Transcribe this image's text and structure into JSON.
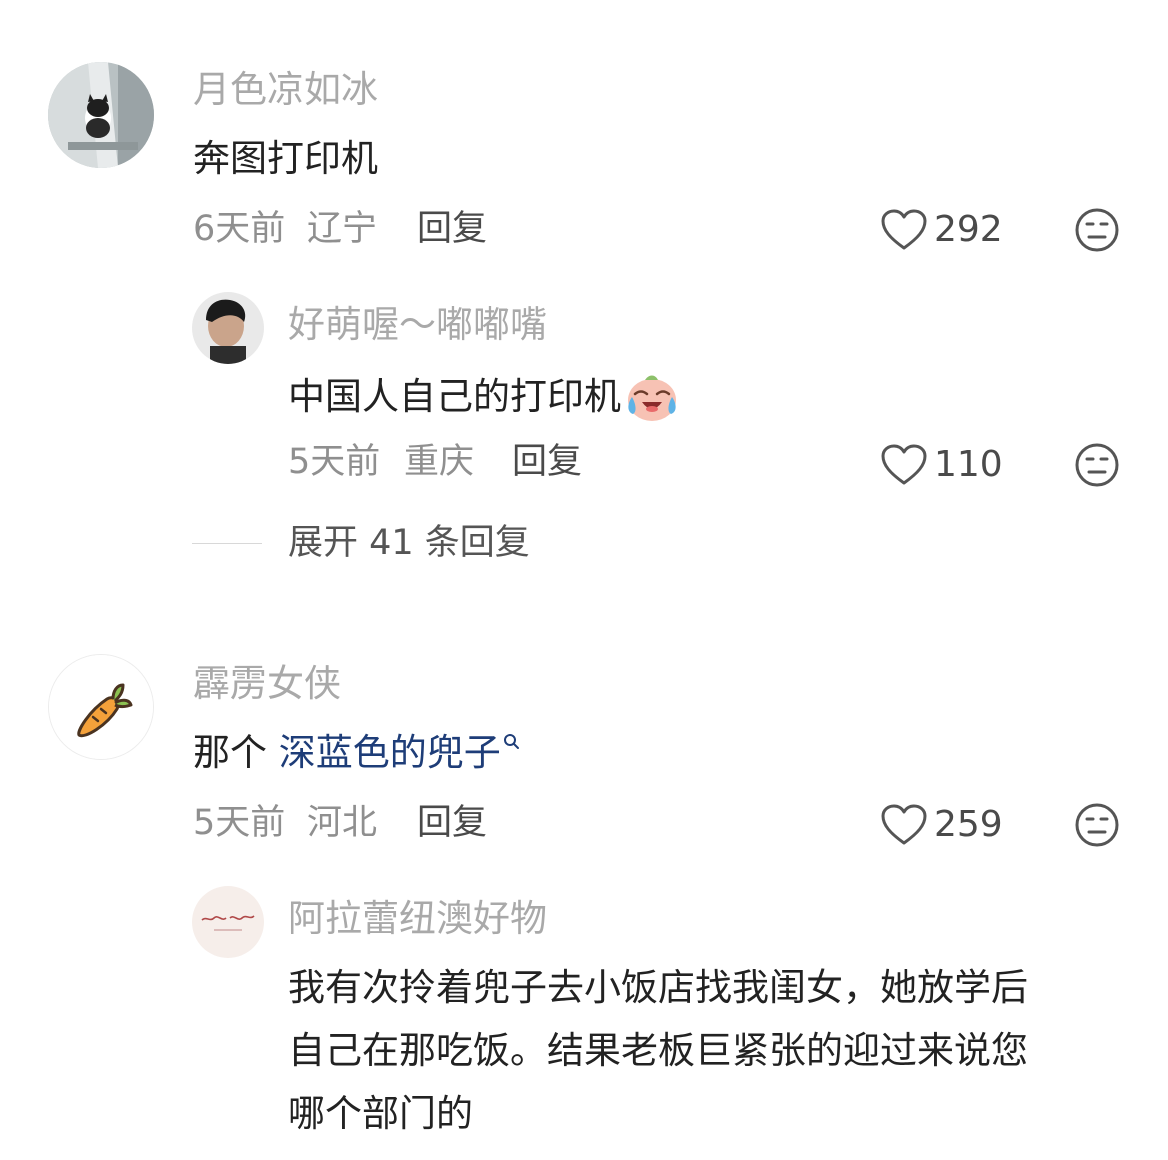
{
  "comments": [
    {
      "username": "月色凉如冰",
      "text": "奔图打印机",
      "time": "6天前",
      "location": "辽宁",
      "reply_label": "回复",
      "likes": "292",
      "replies": [
        {
          "username": "好萌喔～嘟嘟嘴",
          "text": "中国人自己的打印机",
          "emoji": "crying-laughing-peach-emoji",
          "time": "5天前",
          "location": "重庆",
          "reply_label": "回复",
          "likes": "110"
        }
      ],
      "expand_label": "展开 41 条回复"
    },
    {
      "username": "霹雳女侠",
      "text_prefix": "那个 ",
      "text_link": "深蓝色的兜子",
      "time": "5天前",
      "location": "河北",
      "reply_label": "回复",
      "likes": "259",
      "replies": [
        {
          "username": "阿拉蕾纽澳好物",
          "text_lines": [
            "我有次拎着兜子去小饭店找我闺女，她放学后",
            "自己在那吃饭。结果老板巨紧张的迎过来说您",
            "哪个部门的"
          ]
        }
      ]
    }
  ],
  "colors": {
    "username": "#a9a9a9",
    "text": "#222222",
    "meta": "#8f8f8f",
    "link": "#1e3d78",
    "icon": "#555555"
  }
}
